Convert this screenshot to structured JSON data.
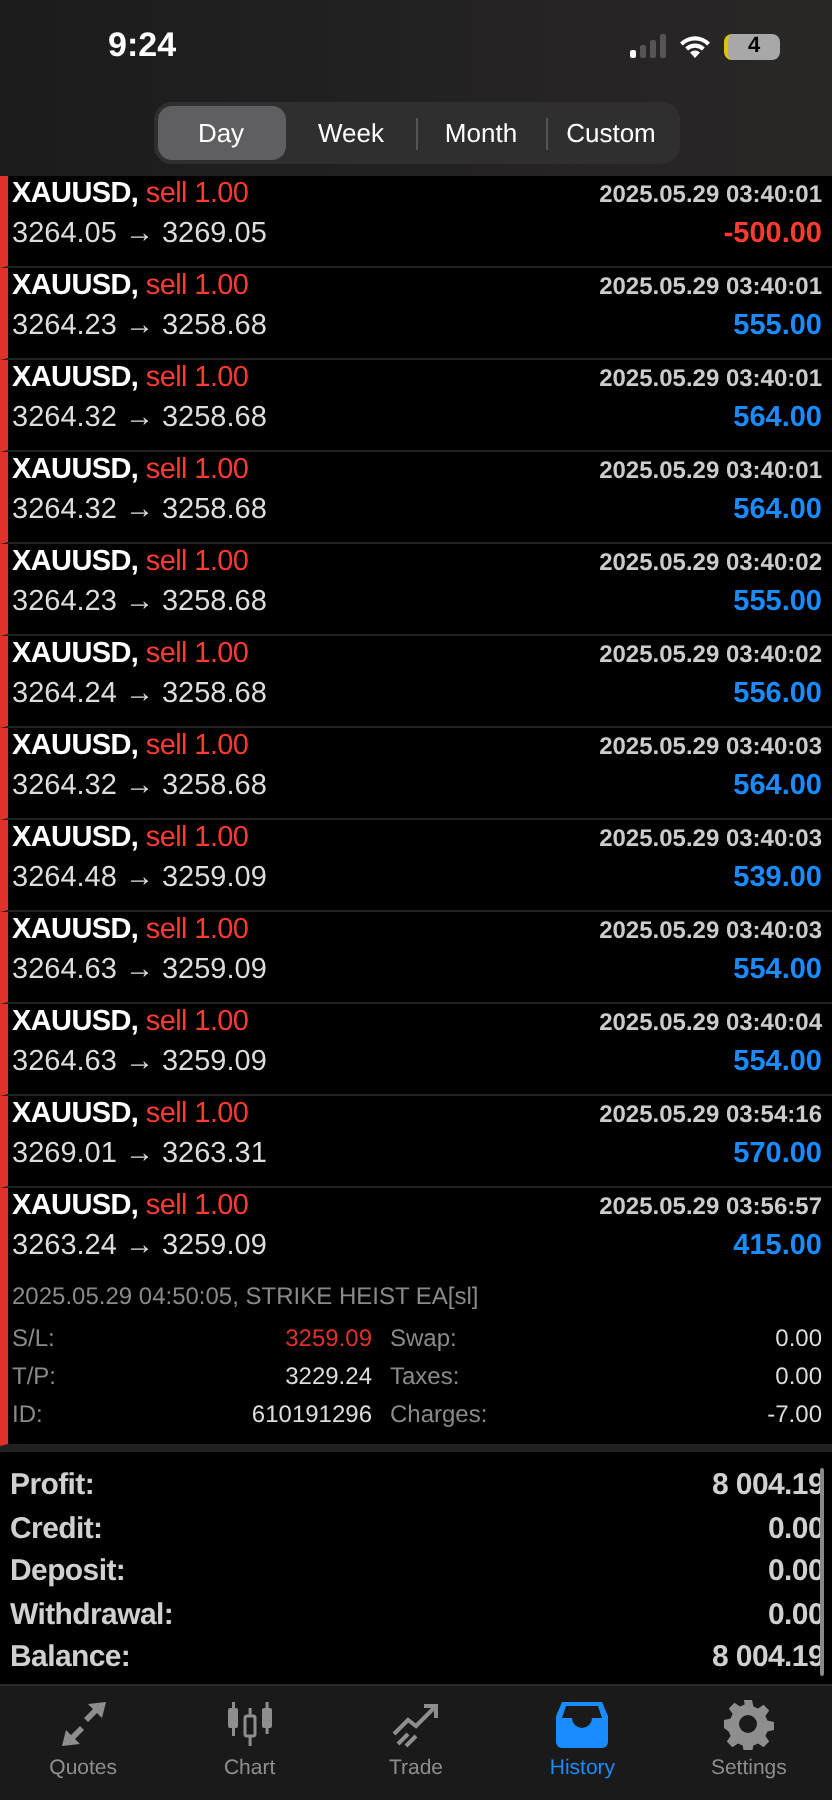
{
  "status_bar": {
    "time": "9:24",
    "battery": "4"
  },
  "periods": [
    {
      "label": "Day",
      "selected": true
    },
    {
      "label": "Week",
      "selected": false
    },
    {
      "label": "Month",
      "selected": false
    },
    {
      "label": "Custom",
      "selected": false
    }
  ],
  "trades": [
    {
      "symbol": "XAUUSD,",
      "action": "sell 1.00",
      "time": "2025.05.29 03:40:01",
      "prices": "3264.05 → 3269.05",
      "profit": "-500.00",
      "loss": true
    },
    {
      "symbol": "XAUUSD,",
      "action": "sell 1.00",
      "time": "2025.05.29 03:40:01",
      "prices": "3264.23 → 3258.68",
      "profit": "555.00",
      "loss": false
    },
    {
      "symbol": "XAUUSD,",
      "action": "sell 1.00",
      "time": "2025.05.29 03:40:01",
      "prices": "3264.32 → 3258.68",
      "profit": "564.00",
      "loss": false
    },
    {
      "symbol": "XAUUSD,",
      "action": "sell 1.00",
      "time": "2025.05.29 03:40:01",
      "prices": "3264.32 → 3258.68",
      "profit": "564.00",
      "loss": false
    },
    {
      "symbol": "XAUUSD,",
      "action": "sell 1.00",
      "time": "2025.05.29 03:40:02",
      "prices": "3264.23 → 3258.68",
      "profit": "555.00",
      "loss": false
    },
    {
      "symbol": "XAUUSD,",
      "action": "sell 1.00",
      "time": "2025.05.29 03:40:02",
      "prices": "3264.24 → 3258.68",
      "profit": "556.00",
      "loss": false
    },
    {
      "symbol": "XAUUSD,",
      "action": "sell 1.00",
      "time": "2025.05.29 03:40:03",
      "prices": "3264.32 → 3258.68",
      "profit": "564.00",
      "loss": false
    },
    {
      "symbol": "XAUUSD,",
      "action": "sell 1.00",
      "time": "2025.05.29 03:40:03",
      "prices": "3264.48 → 3259.09",
      "profit": "539.00",
      "loss": false
    },
    {
      "symbol": "XAUUSD,",
      "action": "sell 1.00",
      "time": "2025.05.29 03:40:03",
      "prices": "3264.63 → 3259.09",
      "profit": "554.00",
      "loss": false
    },
    {
      "symbol": "XAUUSD,",
      "action": "sell 1.00",
      "time": "2025.05.29 03:40:04",
      "prices": "3264.63 → 3259.09",
      "profit": "554.00",
      "loss": false
    },
    {
      "symbol": "XAUUSD,",
      "action": "sell 1.00",
      "time": "2025.05.29 03:54:16",
      "prices": "3269.01 → 3263.31",
      "profit": "570.00",
      "loss": false
    },
    {
      "symbol": "XAUUSD,",
      "action": "sell 1.00",
      "time": "2025.05.29 03:56:57",
      "prices": "3263.24 → 3259.09",
      "profit": "415.00",
      "loss": false,
      "details": {
        "close_info": "2025.05.29 04:50:05, STRIKE HEIST EA[sl]",
        "left": [
          {
            "label": "S/L:",
            "value": "3259.09",
            "hit": true
          },
          {
            "label": "T/P:",
            "value": "3229.24",
            "hit": false
          },
          {
            "label": "ID:",
            "value": "610191296",
            "hit": false
          }
        ],
        "right": [
          {
            "label": "Swap:",
            "value": "0.00"
          },
          {
            "label": "Taxes:",
            "value": "0.00"
          },
          {
            "label": "Charges:",
            "value": "-7.00"
          }
        ]
      }
    }
  ],
  "summary": [
    {
      "label": "Profit:",
      "value": "8 004.19"
    },
    {
      "label": "Credit:",
      "value": "0.00"
    },
    {
      "label": "Deposit:",
      "value": "0.00"
    },
    {
      "label": "Withdrawal:",
      "value": "0.00"
    },
    {
      "label": "Balance:",
      "value": "8 004.19"
    }
  ],
  "tab_bar": [
    {
      "label": "Quotes",
      "selected": false
    },
    {
      "label": "Chart",
      "selected": false
    },
    {
      "label": "Trade",
      "selected": false
    },
    {
      "label": "History",
      "selected": true
    },
    {
      "label": "Settings",
      "selected": false
    }
  ]
}
